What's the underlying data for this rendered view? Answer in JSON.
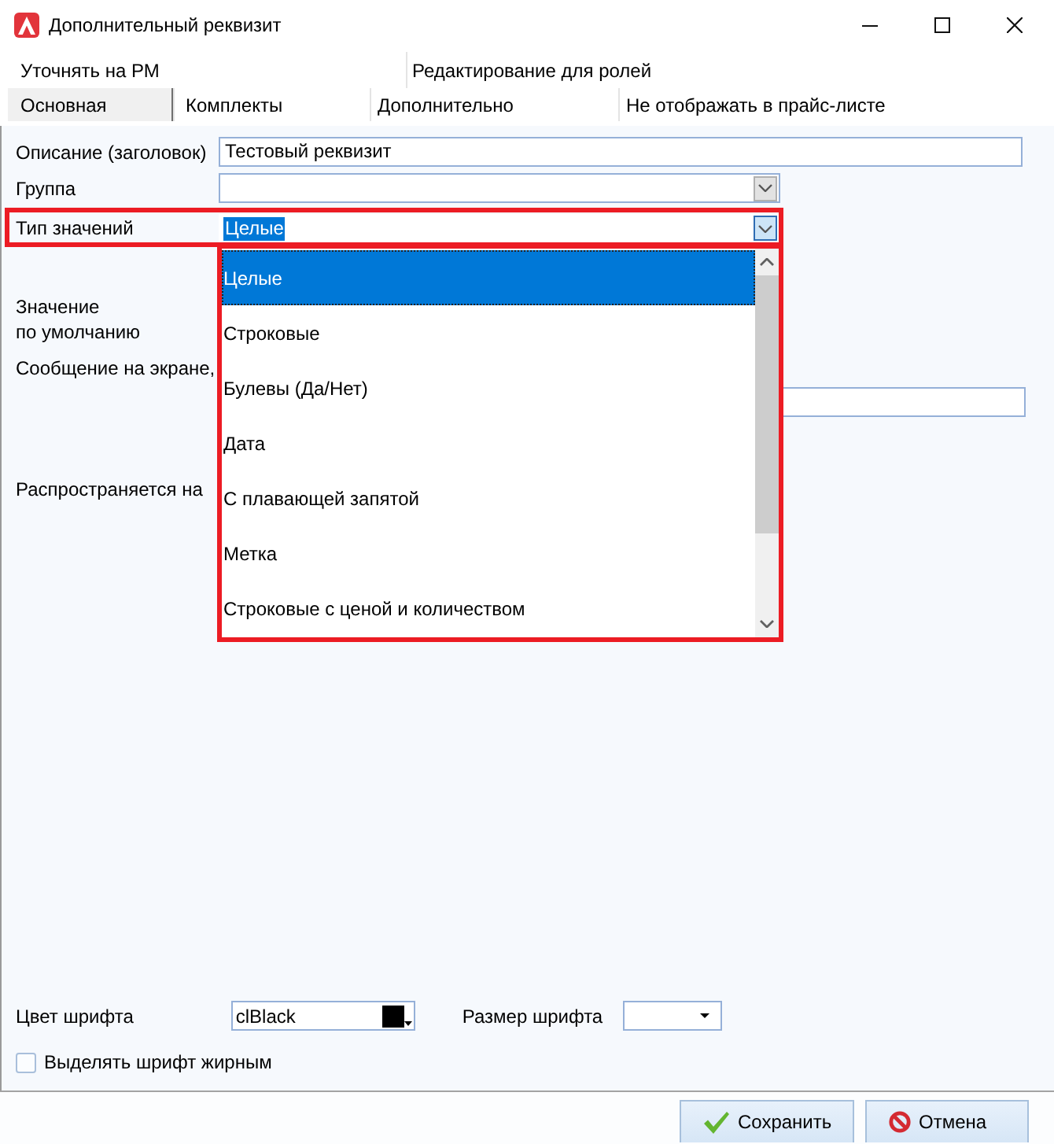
{
  "window": {
    "title": "Дополнительный реквизит"
  },
  "tab_rows": [
    {
      "tabs": [
        {
          "label": "Уточнять на РМ",
          "selected": false
        },
        {
          "label": "Редактирование для ролей",
          "selected": false
        }
      ]
    },
    {
      "tabs": [
        {
          "label": "Основная",
          "selected": true
        },
        {
          "label": "Комплекты",
          "selected": false
        },
        {
          "label": "Дополнительно",
          "selected": false
        },
        {
          "label": "Не отображать в прайс-листе",
          "selected": false
        }
      ]
    }
  ],
  "fields": [
    {
      "kind": "text",
      "label": "Описание (заголовок)",
      "value": "Тестовый реквизит"
    },
    {
      "kind": "combo",
      "label": "Группа",
      "open": false
    },
    {
      "kind": "combo",
      "label": "Тип значений",
      "value": "Целые",
      "open": true,
      "highlighted": true,
      "options": [
        {
          "label": "Целые",
          "selected": true
        },
        {
          "label": "Строковые",
          "selected": false
        },
        {
          "label": "Булевы (Да/Нет)",
          "selected": false
        },
        {
          "label": "Дата",
          "selected": false
        },
        {
          "label": "С плавающей запятой",
          "selected": false
        },
        {
          "label": "Метка",
          "selected": false
        },
        {
          "label": "Строковые с ценой и количеством",
          "selected": false
        }
      ]
    },
    {
      "kind": "caption",
      "label": "Значение\nпо умолчанию"
    },
    {
      "kind": "memo",
      "label": "Сообщение на экране,"
    },
    {
      "kind": "caption",
      "label": "Распространяется на"
    }
  ],
  "font": {
    "color_label": "Цвет шрифта",
    "color_value": "clBlack",
    "color": "#000000",
    "size_label": "Размер шрифта",
    "bold_label": "Выделять шрифт жирным",
    "bold_checked": false
  },
  "buttons": [
    {
      "kind": "save",
      "label": "Сохранить"
    },
    {
      "kind": "cancel",
      "label": "Отмена"
    }
  ]
}
